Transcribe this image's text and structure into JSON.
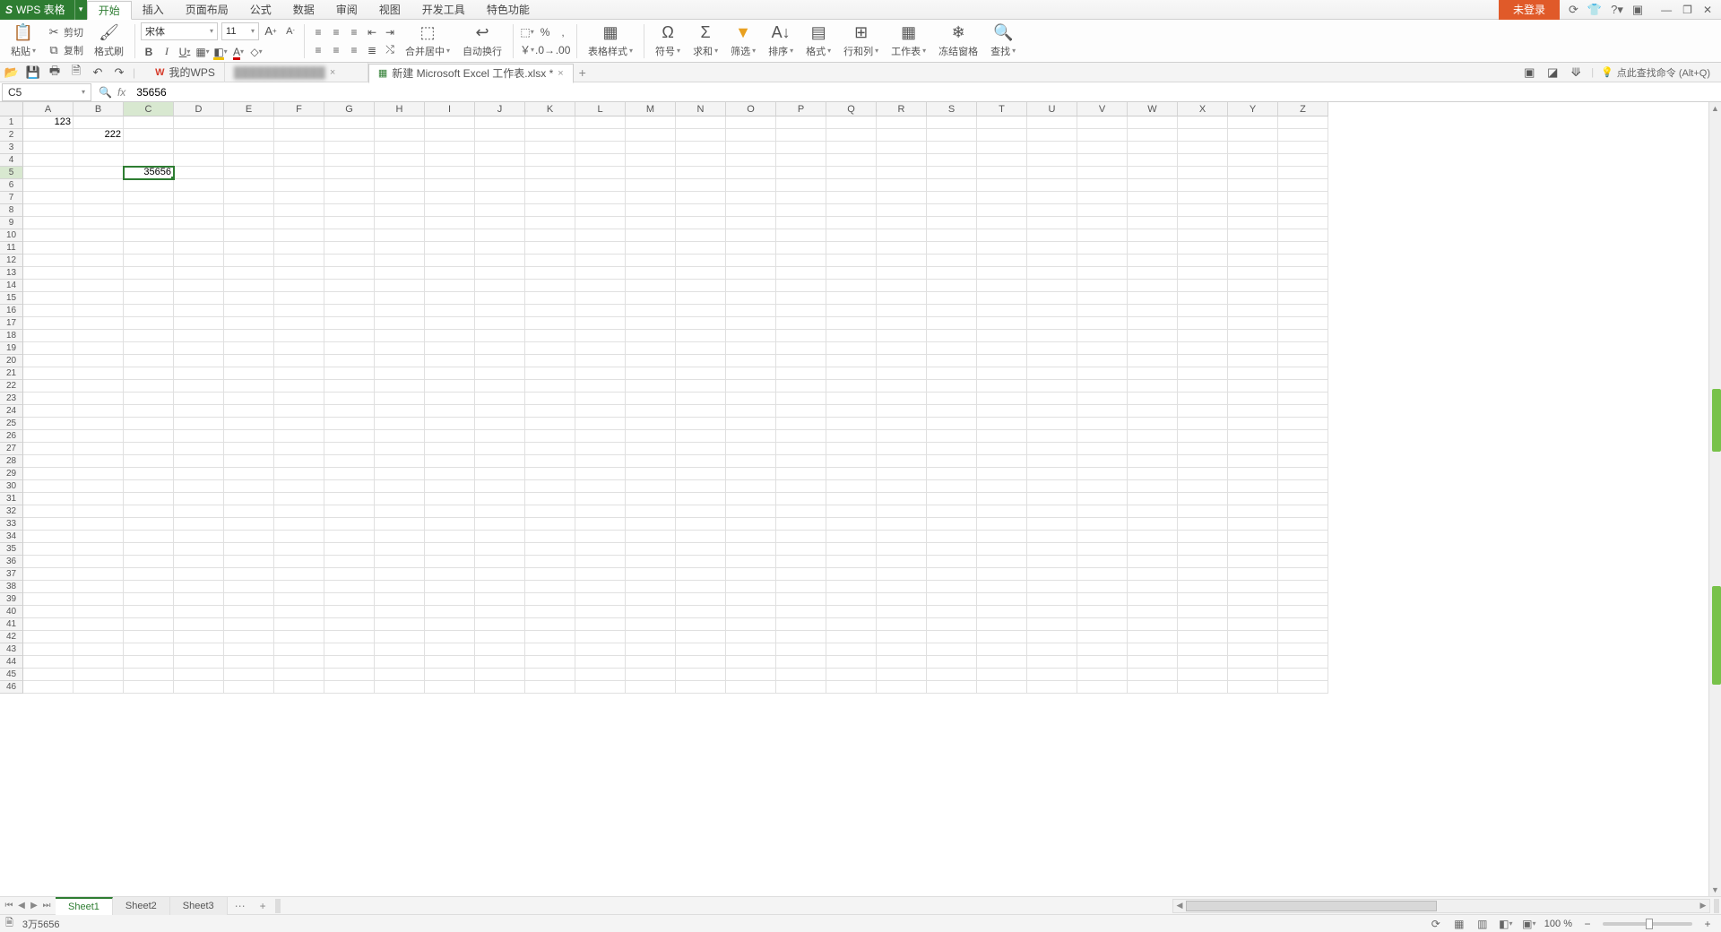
{
  "app": {
    "name": "WPS 表格",
    "login": "未登录"
  },
  "menu": {
    "items": [
      "开始",
      "插入",
      "页面布局",
      "公式",
      "数据",
      "审阅",
      "视图",
      "开发工具",
      "特色功能"
    ],
    "active": 0
  },
  "ribbon": {
    "paste": "粘贴",
    "cut": "剪切",
    "copy": "复制",
    "format_painter": "格式刷",
    "font_name": "宋体",
    "font_size": "11",
    "merge": "合并居中",
    "wrap": "自动换行",
    "table_style": "表格样式",
    "symbol": "符号",
    "sum": "求和",
    "filter": "筛选",
    "sort": "排序",
    "format": "格式",
    "row_col": "行和列",
    "worksheet": "工作表",
    "freeze": "冻结窗格",
    "find": "查找"
  },
  "docs": {
    "mywps": "我的WPS",
    "active_doc": "新建 Microsoft Excel 工作表.xlsx *"
  },
  "search_hint": "点此查找命令 (Alt+Q)",
  "name_box": "C5",
  "formula": "35656",
  "columns": [
    "A",
    "B",
    "C",
    "D",
    "E",
    "F",
    "G",
    "H",
    "I",
    "J",
    "K",
    "L",
    "M",
    "N",
    "O",
    "P",
    "Q",
    "R",
    "S",
    "T",
    "U",
    "V",
    "W",
    "X",
    "Y",
    "Z"
  ],
  "selected_col_index": 2,
  "selected_row_index": 4,
  "row_count": 46,
  "cells": {
    "A1": "123",
    "B2": "222",
    "C5": "35656"
  },
  "sheets": {
    "items": [
      "Sheet1",
      "Sheet2",
      "Sheet3"
    ],
    "active": 0
  },
  "status": {
    "reading": "3万5656",
    "zoom": "100 %"
  }
}
